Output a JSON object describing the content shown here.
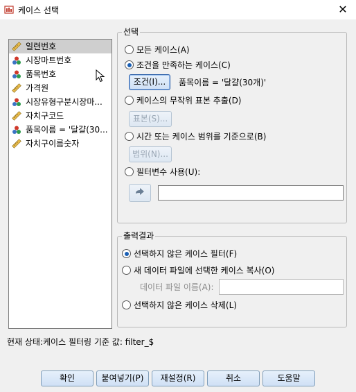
{
  "window": {
    "title": "케이스 선택",
    "close_glyph": "✕"
  },
  "variables": [
    {
      "label": "일련번호",
      "icon": "ruler-icon",
      "selected": true
    },
    {
      "label": "시장마트번호",
      "icon": "nominal-icon"
    },
    {
      "label": "품목번호",
      "icon": "nominal-icon"
    },
    {
      "label": "가격원",
      "icon": "ruler-icon"
    },
    {
      "label": "시장유형구분시장마...",
      "icon": "nominal-icon"
    },
    {
      "label": "자치구코드",
      "icon": "ruler-icon"
    },
    {
      "label": "품목이름 = '달걀(30...",
      "icon": "nominal-icon"
    },
    {
      "label": "자치구이름숫자",
      "icon": "ruler-icon"
    }
  ],
  "select_group": {
    "title": "선택",
    "all_cases": "모든 케이스(A)",
    "if_condition": "조건을 만족하는 케이스(C)",
    "if_button": "조건(I)...",
    "condition_text": "품목이름 = '달걀(30개)'",
    "random_sample": "케이스의 무작위 표본 추출(D)",
    "sample_button": "표본(S)...",
    "range": "시간 또는 케이스 범위를 기준으로(B)",
    "range_button": "범위(N)...",
    "filter_var": "필터변수 사용(U):",
    "selected_option": "if_condition"
  },
  "output_group": {
    "title": "출력결과",
    "filter_out": "선택하지 않은 케이스 필터(F)",
    "copy_to_new": "새 데이터 파일에 선택한 케이스 복사(O)",
    "dataset_name_label": "데이터 파일 이름(A):",
    "delete": "선택하지 않은 케이스 삭제(L)",
    "selected_option": "filter_out"
  },
  "status": "현재 상태:케이스 필터링 기준 값: filter_$",
  "buttons": {
    "ok": "확인",
    "paste": "붙여넣기(P)",
    "reset": "재설정(R)",
    "cancel": "취소",
    "help": "도움말"
  }
}
